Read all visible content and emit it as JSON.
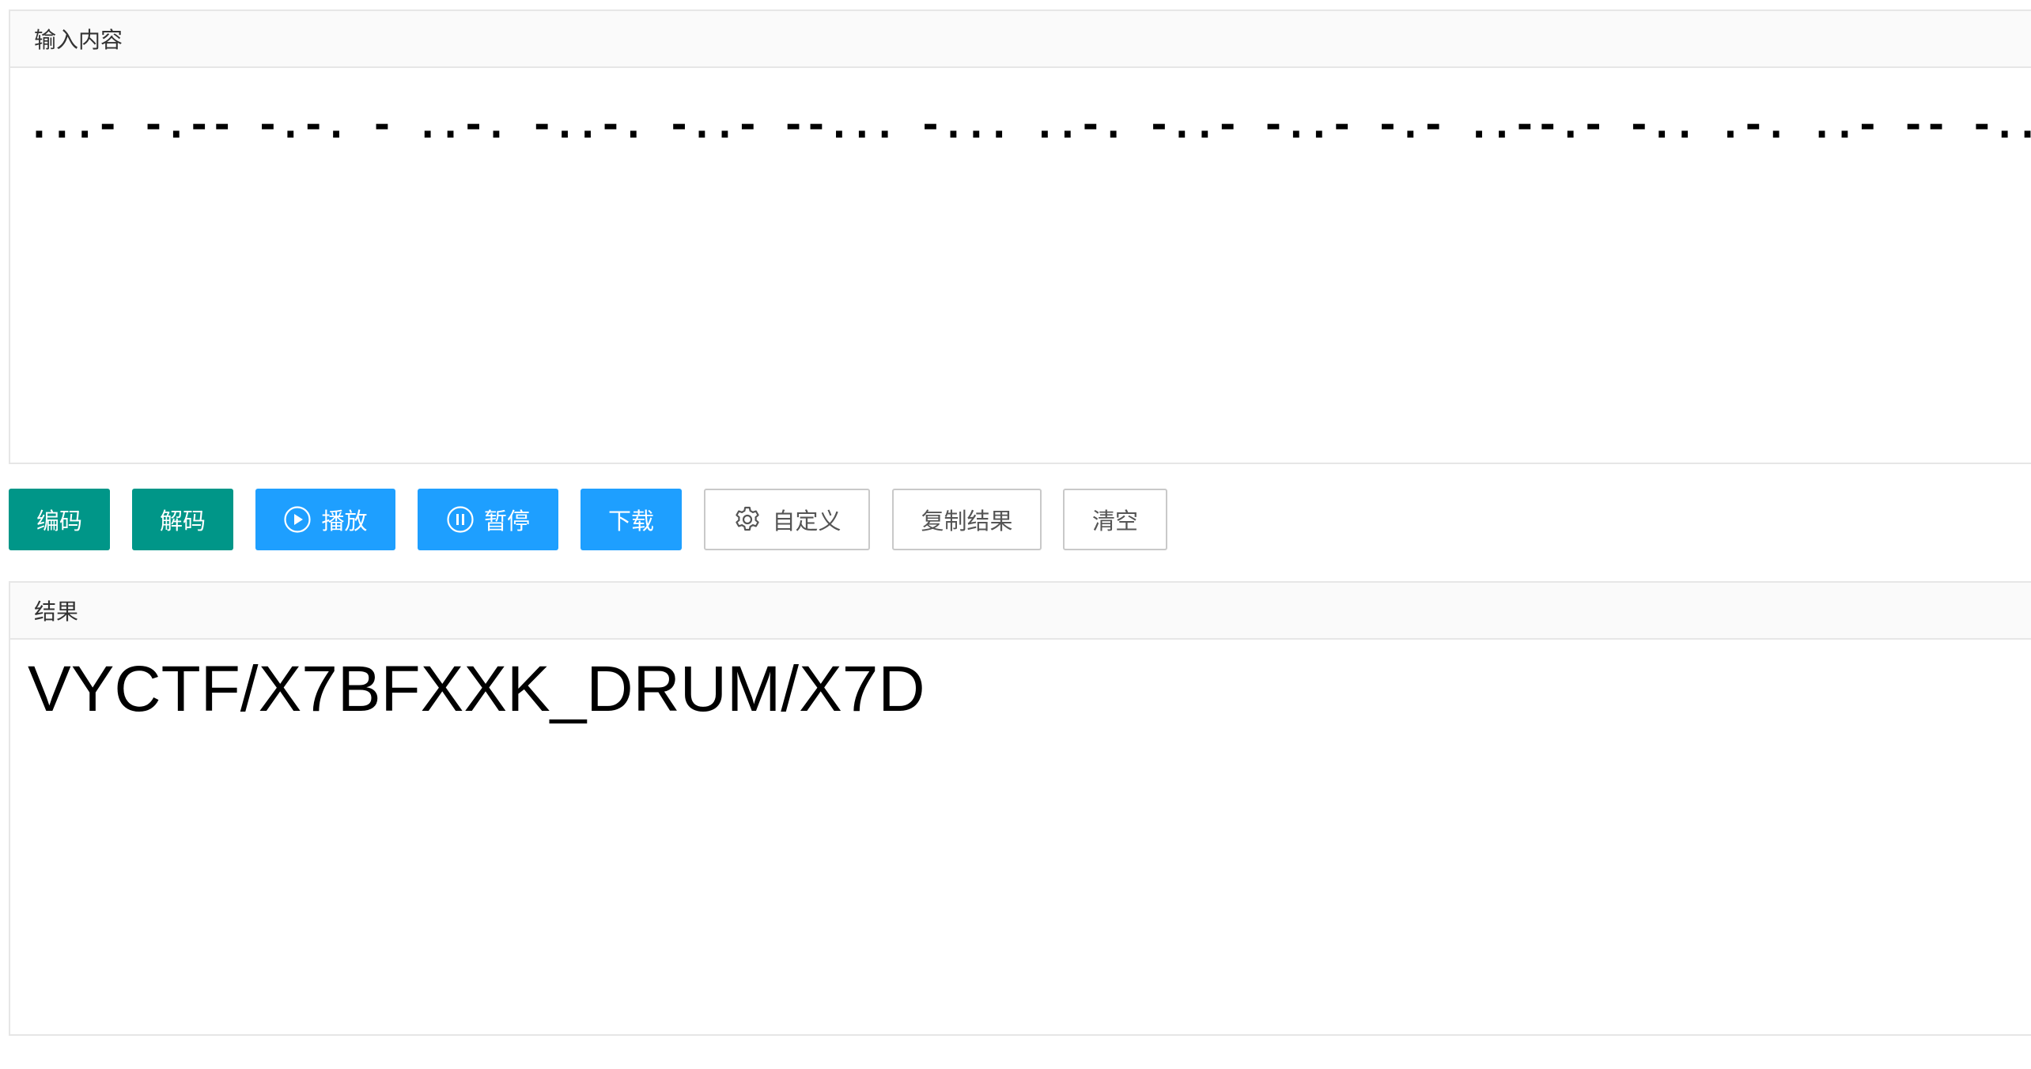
{
  "input_panel": {
    "header": "输入内容",
    "value": "...- -.-- -.-. - ..-. -..-. -..- --... -... ..-. -..- -..- -.- ..--.- -.. .-. ..- -- -..-. -..- --... -.."
  },
  "toolbar": {
    "encode_label": "编码",
    "decode_label": "解码",
    "play_label": "播放",
    "pause_label": "暂停",
    "download_label": "下载",
    "custom_label": "自定义",
    "copy_label": "复制结果",
    "clear_label": "清空"
  },
  "result_panel": {
    "header": "结果",
    "value": "VYCTF/X7BFXXK_DRUM/X7D"
  },
  "colors": {
    "green": "#009688",
    "blue": "#1e9fff",
    "header_bg": "#fafafa",
    "border": "#e6e6e6"
  },
  "icons": {
    "play": "play-circle-icon",
    "pause": "pause-circle-icon",
    "custom": "gear-icon"
  }
}
